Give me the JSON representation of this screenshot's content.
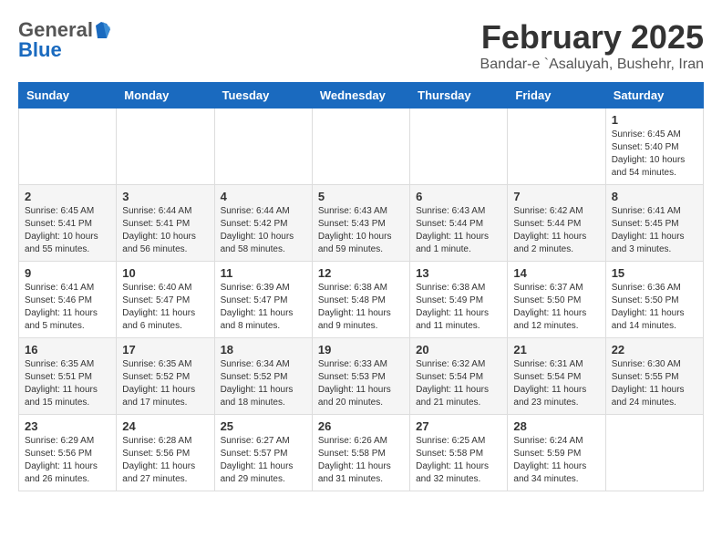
{
  "header": {
    "logo_general": "General",
    "logo_blue": "Blue",
    "title": "February 2025",
    "subtitle": "Bandar-e `Asaluyah, Bushehr, Iran"
  },
  "days_of_week": [
    "Sunday",
    "Monday",
    "Tuesday",
    "Wednesday",
    "Thursday",
    "Friday",
    "Saturday"
  ],
  "weeks": [
    [
      {
        "day": "",
        "info": ""
      },
      {
        "day": "",
        "info": ""
      },
      {
        "day": "",
        "info": ""
      },
      {
        "day": "",
        "info": ""
      },
      {
        "day": "",
        "info": ""
      },
      {
        "day": "",
        "info": ""
      },
      {
        "day": "1",
        "info": "Sunrise: 6:45 AM\nSunset: 5:40 PM\nDaylight: 10 hours\nand 54 minutes."
      }
    ],
    [
      {
        "day": "2",
        "info": "Sunrise: 6:45 AM\nSunset: 5:41 PM\nDaylight: 10 hours\nand 55 minutes."
      },
      {
        "day": "3",
        "info": "Sunrise: 6:44 AM\nSunset: 5:41 PM\nDaylight: 10 hours\nand 56 minutes."
      },
      {
        "day": "4",
        "info": "Sunrise: 6:44 AM\nSunset: 5:42 PM\nDaylight: 10 hours\nand 58 minutes."
      },
      {
        "day": "5",
        "info": "Sunrise: 6:43 AM\nSunset: 5:43 PM\nDaylight: 10 hours\nand 59 minutes."
      },
      {
        "day": "6",
        "info": "Sunrise: 6:43 AM\nSunset: 5:44 PM\nDaylight: 11 hours\nand 1 minute."
      },
      {
        "day": "7",
        "info": "Sunrise: 6:42 AM\nSunset: 5:44 PM\nDaylight: 11 hours\nand 2 minutes."
      },
      {
        "day": "8",
        "info": "Sunrise: 6:41 AM\nSunset: 5:45 PM\nDaylight: 11 hours\nand 3 minutes."
      }
    ],
    [
      {
        "day": "9",
        "info": "Sunrise: 6:41 AM\nSunset: 5:46 PM\nDaylight: 11 hours\nand 5 minutes."
      },
      {
        "day": "10",
        "info": "Sunrise: 6:40 AM\nSunset: 5:47 PM\nDaylight: 11 hours\nand 6 minutes."
      },
      {
        "day": "11",
        "info": "Sunrise: 6:39 AM\nSunset: 5:47 PM\nDaylight: 11 hours\nand 8 minutes."
      },
      {
        "day": "12",
        "info": "Sunrise: 6:38 AM\nSunset: 5:48 PM\nDaylight: 11 hours\nand 9 minutes."
      },
      {
        "day": "13",
        "info": "Sunrise: 6:38 AM\nSunset: 5:49 PM\nDaylight: 11 hours\nand 11 minutes."
      },
      {
        "day": "14",
        "info": "Sunrise: 6:37 AM\nSunset: 5:50 PM\nDaylight: 11 hours\nand 12 minutes."
      },
      {
        "day": "15",
        "info": "Sunrise: 6:36 AM\nSunset: 5:50 PM\nDaylight: 11 hours\nand 14 minutes."
      }
    ],
    [
      {
        "day": "16",
        "info": "Sunrise: 6:35 AM\nSunset: 5:51 PM\nDaylight: 11 hours\nand 15 minutes."
      },
      {
        "day": "17",
        "info": "Sunrise: 6:35 AM\nSunset: 5:52 PM\nDaylight: 11 hours\nand 17 minutes."
      },
      {
        "day": "18",
        "info": "Sunrise: 6:34 AM\nSunset: 5:52 PM\nDaylight: 11 hours\nand 18 minutes."
      },
      {
        "day": "19",
        "info": "Sunrise: 6:33 AM\nSunset: 5:53 PM\nDaylight: 11 hours\nand 20 minutes."
      },
      {
        "day": "20",
        "info": "Sunrise: 6:32 AM\nSunset: 5:54 PM\nDaylight: 11 hours\nand 21 minutes."
      },
      {
        "day": "21",
        "info": "Sunrise: 6:31 AM\nSunset: 5:54 PM\nDaylight: 11 hours\nand 23 minutes."
      },
      {
        "day": "22",
        "info": "Sunrise: 6:30 AM\nSunset: 5:55 PM\nDaylight: 11 hours\nand 24 minutes."
      }
    ],
    [
      {
        "day": "23",
        "info": "Sunrise: 6:29 AM\nSunset: 5:56 PM\nDaylight: 11 hours\nand 26 minutes."
      },
      {
        "day": "24",
        "info": "Sunrise: 6:28 AM\nSunset: 5:56 PM\nDaylight: 11 hours\nand 27 minutes."
      },
      {
        "day": "25",
        "info": "Sunrise: 6:27 AM\nSunset: 5:57 PM\nDaylight: 11 hours\nand 29 minutes."
      },
      {
        "day": "26",
        "info": "Sunrise: 6:26 AM\nSunset: 5:58 PM\nDaylight: 11 hours\nand 31 minutes."
      },
      {
        "day": "27",
        "info": "Sunrise: 6:25 AM\nSunset: 5:58 PM\nDaylight: 11 hours\nand 32 minutes."
      },
      {
        "day": "28",
        "info": "Sunrise: 6:24 AM\nSunset: 5:59 PM\nDaylight: 11 hours\nand 34 minutes."
      },
      {
        "day": "",
        "info": ""
      }
    ]
  ]
}
